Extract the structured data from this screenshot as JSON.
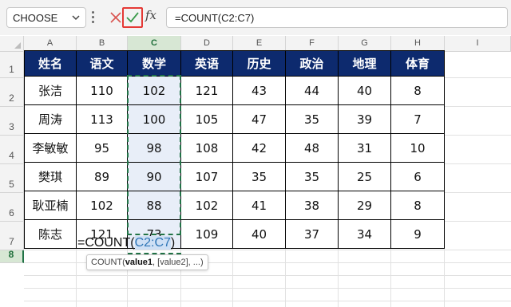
{
  "formula_bar": {
    "name_box": "CHOOSE",
    "fx_label": "fx",
    "formula": "=COUNT(C2:C7)"
  },
  "columns": [
    "A",
    "B",
    "C",
    "D",
    "E",
    "F",
    "G",
    "H",
    "I"
  ],
  "active_column": "C",
  "rows": [
    "1",
    "2",
    "3",
    "4",
    "5",
    "6",
    "7",
    "8"
  ],
  "active_row": "8",
  "table": {
    "headers": [
      "姓名",
      "语文",
      "数学",
      "英语",
      "历史",
      "政治",
      "地理",
      "体育"
    ],
    "rows": [
      [
        "张洁",
        "110",
        "102",
        "121",
        "43",
        "44",
        "40",
        "8"
      ],
      [
        "周涛",
        "113",
        "100",
        "105",
        "47",
        "35",
        "39",
        "7"
      ],
      [
        "李敏敏",
        "95",
        "98",
        "108",
        "42",
        "48",
        "31",
        "10"
      ],
      [
        "樊琪",
        "89",
        "90",
        "107",
        "35",
        "35",
        "25",
        "6"
      ],
      [
        "耿亚楠",
        "102",
        "88",
        "102",
        "41",
        "38",
        "29",
        "8"
      ],
      [
        "陈志",
        "121",
        "73",
        "109",
        "40",
        "37",
        "34",
        "9"
      ]
    ]
  },
  "cell_edit": {
    "prefix": "=COUNT(",
    "ref": "C2:C7",
    "suffix": ")"
  },
  "tooltip": {
    "func": "COUNT(",
    "arg1": "value1",
    "rest": ", [value2], ...)"
  },
  "colors": {
    "header_bg": "#0d2a6e",
    "accent_green": "#217346",
    "highlight_red": "#e53935",
    "ref_blue": "#2e75b6"
  }
}
